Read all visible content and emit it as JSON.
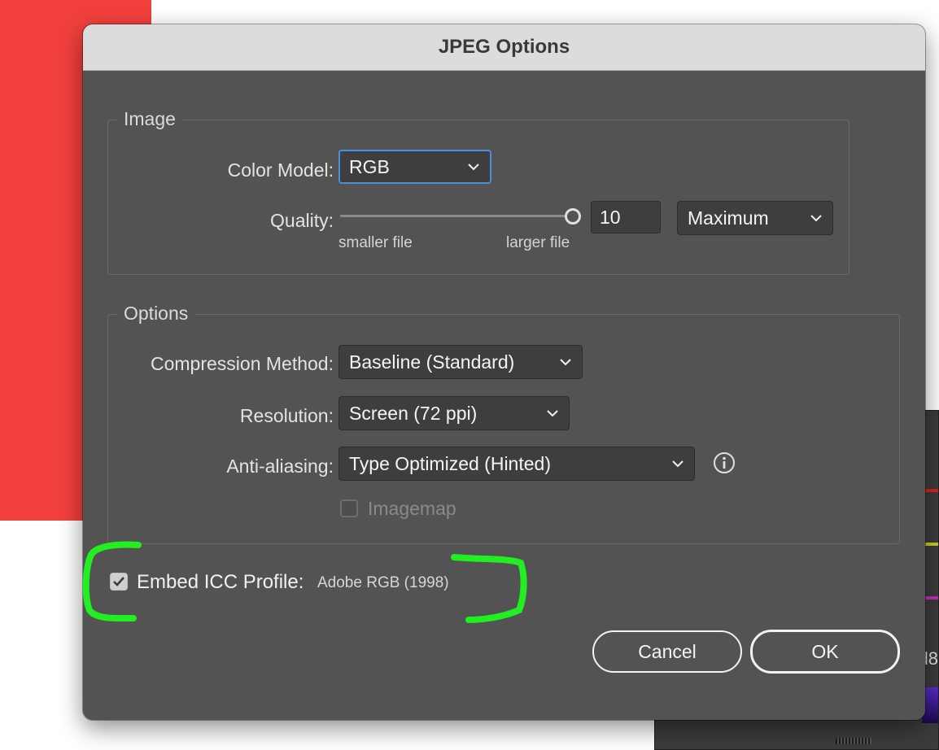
{
  "dialog": {
    "title": "JPEG Options"
  },
  "image_group": {
    "legend": "Image",
    "color_model": {
      "label": "Color Model:",
      "value": "RGB"
    },
    "quality": {
      "label": "Quality:",
      "value": "10",
      "slider_fraction": 1.0,
      "min_label": "smaller file",
      "max_label": "larger file",
      "preset": "Maximum"
    }
  },
  "options_group": {
    "legend": "Options",
    "compression": {
      "label": "Compression Method:",
      "value": "Baseline (Standard)"
    },
    "resolution": {
      "label": "Resolution:",
      "value": "Screen (72 ppi)"
    },
    "anti_aliasing": {
      "label": "Anti-aliasing:",
      "value": "Type Optimized (Hinted)"
    },
    "imagemap": {
      "label": "Imagemap",
      "checked": false,
      "enabled": false
    }
  },
  "embed_icc": {
    "label": "Embed ICC Profile:",
    "value": "Adobe RGB (1998)",
    "checked": true
  },
  "buttons": {
    "cancel": "Cancel",
    "ok": "OK"
  },
  "background": {
    "partial_text": "d8"
  },
  "colors": {
    "dialog_bg": "#535353",
    "titlebar_bg": "#dcdcdc",
    "focus_ring": "#4a90e2",
    "annotation": "#22ee22",
    "background_red": "#f2403c"
  }
}
